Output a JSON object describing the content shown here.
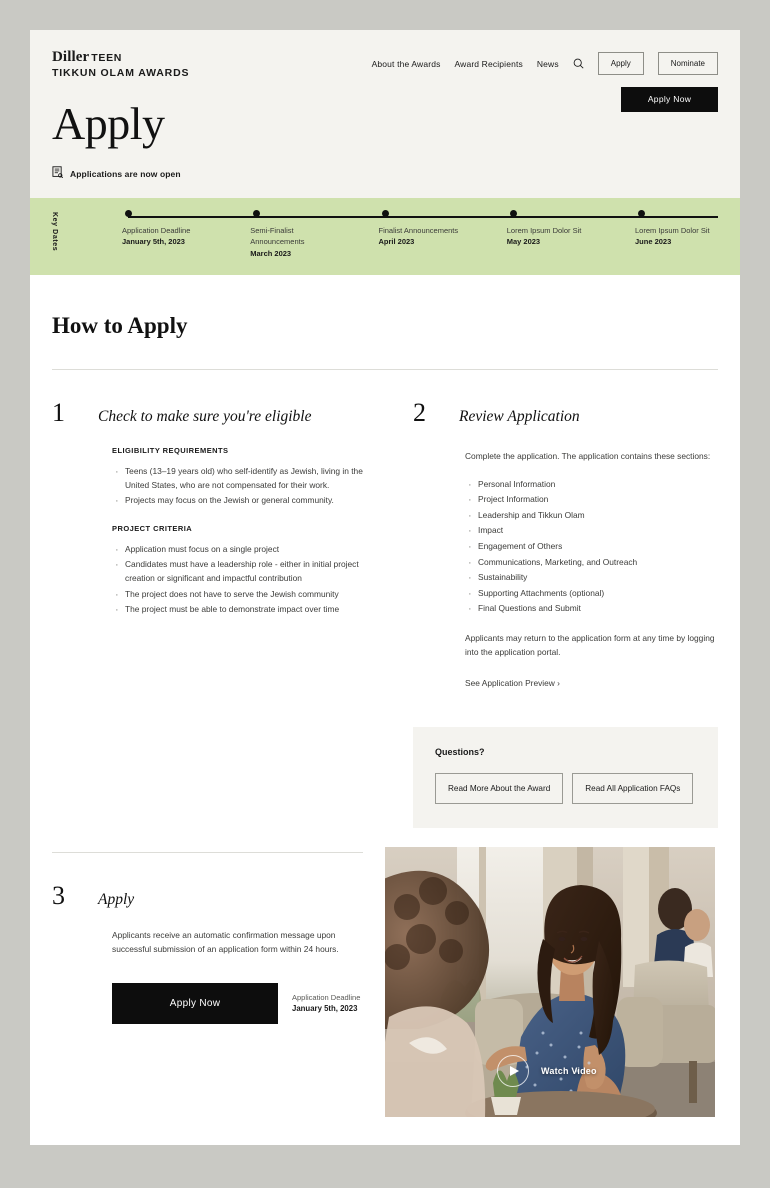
{
  "header": {
    "logo": {
      "brand": "Diller",
      "teen": "TEEN",
      "line2": "TIKKUN OLAM AWARDS"
    },
    "nav_links": [
      {
        "label": "About the Awards"
      },
      {
        "label": "Award Recipients"
      },
      {
        "label": "News"
      }
    ],
    "search_icon": "search-icon",
    "buttons": [
      {
        "label": "Apply"
      },
      {
        "label": "Nominate"
      }
    ]
  },
  "hero": {
    "title": "Apply",
    "status_icon": "document-search-icon",
    "status_text": "Applications are now open",
    "cta_label": "Apply Now",
    "background_color": "#f4f3ef"
  },
  "key_dates": {
    "label": "Key Dates",
    "background_color": "#cfe1ad",
    "items": [
      {
        "name": "Application Deadline",
        "date": "January 5th, 2023"
      },
      {
        "name": "Semi-Finalist Announcements",
        "date": "March 2023"
      },
      {
        "name": "Finalist Announcements",
        "date": "April 2023"
      },
      {
        "name": "Lorem Ipsum Dolor Sit",
        "date": "May 2023"
      },
      {
        "name": "Lorem Ipsum Dolor Sit",
        "date": "June 2023"
      }
    ]
  },
  "how_to_apply": {
    "section_title": "How to Apply",
    "step1": {
      "number": "1",
      "title": "Check to make sure you're eligible",
      "eligibility_heading": "ELIGIBILITY REQUIREMENTS",
      "eligibility_items": [
        "Teens (13–19 years old) who self-identify as Jewish, living in the United States, who are not compensated for their work.",
        "Projects may focus on the Jewish or general community."
      ],
      "criteria_heading": "PROJECT CRITERIA",
      "criteria_items": [
        "Application must focus on a single project",
        "Candidates must have a leadership role - either in initial project creation or significant and impactful contribution",
        "The project does not have to serve the Jewish community",
        "The project must be able to demonstrate impact over time"
      ]
    },
    "step2": {
      "number": "2",
      "title": "Review Application",
      "intro": "Complete the application. The application contains these sections:",
      "sections": [
        "Personal Information",
        "Project Information",
        "Leadership and Tikkun Olam",
        "Impact",
        "Engagement of Others",
        "Communications, Marketing, and Outreach",
        "Sustainability",
        "Supporting Attachments (optional)",
        "Final Questions and Submit"
      ],
      "outro": "Applicants may return to the application form at any time by logging into the application portal.",
      "link_label": "See Application Preview ›"
    },
    "questions": {
      "title": "Questions?",
      "buttons": [
        {
          "label": "Read More About the Award"
        },
        {
          "label": "Read All Application FAQs"
        }
      ]
    },
    "step3": {
      "number": "3",
      "title": "Apply",
      "body": "Applicants receive an automatic confirmation message upon successful submission of an application form within 24 hours.",
      "cta_label": "Apply Now",
      "deadline_label": "Application Deadline",
      "deadline_value": "January 5th, 2023"
    },
    "video": {
      "label": "Watch Video",
      "play_icon": "play-icon"
    }
  }
}
